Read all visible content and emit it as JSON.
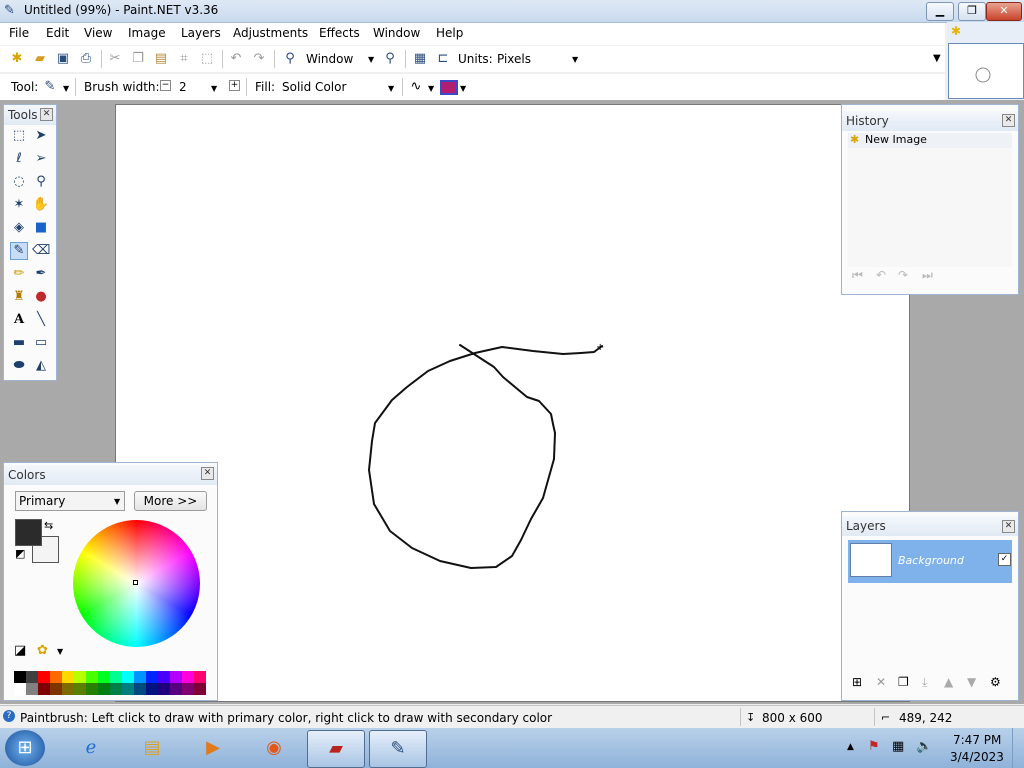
{
  "window": {
    "title": "Untitled (99%) - Paint.NET v3.36",
    "minimize": "▁",
    "maximize": "❐",
    "close": "✕"
  },
  "menu": [
    "File",
    "Edit",
    "View",
    "Image",
    "Layers",
    "Adjustments",
    "Effects",
    "Window",
    "Help"
  ],
  "toolbar": {
    "zoom_mode": "Window",
    "units_label": "Units:",
    "units_value": "Pixels",
    "tool_label": "Tool:",
    "brush_width_label": "Brush width:",
    "brush_width_value": "2",
    "fill_label": "Fill:",
    "fill_value": "Solid Color"
  },
  "tools_panel": {
    "title": "Tools"
  },
  "history_panel": {
    "title": "History",
    "items": [
      "New Image"
    ]
  },
  "layers_panel": {
    "title": "Layers",
    "layers": [
      {
        "name": "Background",
        "visible": true
      }
    ]
  },
  "colors_panel": {
    "title": "Colors",
    "mode": "Primary",
    "more_button": "More >>",
    "primary_color": "#2b2b2b",
    "secondary_color": "#f4f4f4",
    "palette_top": [
      "#000000",
      "#404040",
      "#ff0000",
      "#ff6a00",
      "#ffd800",
      "#b6ff00",
      "#4cff00",
      "#00ff21",
      "#00ff90",
      "#00ffff",
      "#0094ff",
      "#0026ff",
      "#4800ff",
      "#b200ff",
      "#ff00dc",
      "#ff006e"
    ],
    "palette_bottom": [
      "#ffffff",
      "#808080",
      "#7f0000",
      "#7f3300",
      "#7f6a00",
      "#5b7f00",
      "#267f00",
      "#007f0e",
      "#007f46",
      "#007f7f",
      "#004a7f",
      "#00137f",
      "#21007f",
      "#57007f",
      "#7f006e",
      "#7f0037"
    ]
  },
  "status": {
    "hint": "Paintbrush: Left click to draw with primary color, right click to draw with secondary color",
    "image_size": "800 x 600",
    "cursor_position": "489, 242"
  },
  "taskbar": {
    "time": "7:47 PM",
    "date": "3/4/2023",
    "apps": [
      "start-button",
      "internet-explorer",
      "file-explorer",
      "media-player",
      "firefox",
      "toolbox",
      "paint-net"
    ]
  }
}
